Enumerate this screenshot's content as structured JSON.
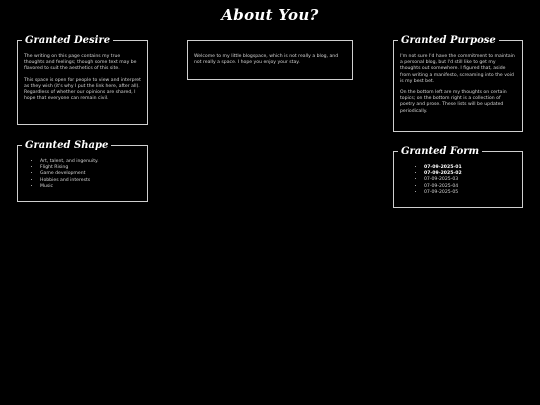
{
  "title": "About You?",
  "center": {
    "text": "Welcome to my little blogspace, which is not really a blog, and not really a space. I hope you enjoy your stay."
  },
  "desire": {
    "title": "Granted Desire",
    "p1": "The writing on this page contains my true thoughts and feelings; though some text may be flavored to suit the aesthetics of this site.",
    "p2": "This space is open for people to view and interpret as they wish (it's why I put the link here, after all). Regardless of whether our opinions are shared, I hope that everyone can remain civil."
  },
  "purpose": {
    "title": "Granted Purpose",
    "p1": "I'm not sure I'd have the commitment to maintain a personal blog, but I'd still like to get my thoughts out somewhere. I figured that, aside from writing a manifesto, screaming into the void is my best bet.",
    "p2": "On the bottom left are my thoughts on certain topics; on the bottom right is a collection of poetry and prose. These lists will be updated periodically."
  },
  "shape": {
    "title": "Granted Shape",
    "items": [
      "Art, talent, and ingenuity.",
      "Flight Rising",
      "Game development",
      "Hobbies and interests",
      "Music"
    ]
  },
  "form": {
    "title": "Granted Form",
    "items": [
      "07-09-2025-01",
      "07-09-2025-02",
      "07-09-2025-03",
      "07-09-2025-04",
      "07-09-2025-05"
    ]
  }
}
